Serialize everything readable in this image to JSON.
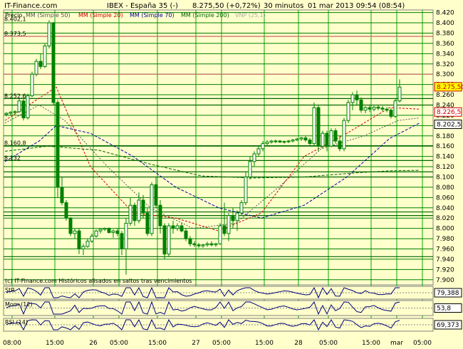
{
  "header": {
    "brand": "IT-Finance.com",
    "title": "IBEX - España 35 (-)",
    "quote": "8.275,50 (+0,72%)",
    "period": "30 minutos",
    "datetime": "01 mar 2013 09:54 (08:54)"
  },
  "legend": {
    "precio": "Precio",
    "mm50": "MM (Simple 50)",
    "mm20": "MM (Simple 20)",
    "mm70": "MM (Simple 70)",
    "mm200": "MM (Simple 200)",
    "vnp": "VNP (25,1)"
  },
  "footer_note": "(c) IT-Finance.com  Históricos alisados en saltos tras vencimientos",
  "colors": {
    "background": "#ffffcc",
    "grid_h": "#008000",
    "grid_v": "#00aa00",
    "candle": "#008000",
    "mm20": "#cc0000",
    "mm50": "#555555",
    "mm70": "#000099",
    "mm200": "#006600"
  },
  "chart_data": {
    "type": "candlestick",
    "y_ticks": [
      "8.420",
      "8.400",
      "8.380",
      "8.360",
      "8.340",
      "8.320",
      "8.300",
      "8.280",
      "8.260",
      "8.240",
      "8.220",
      "8.200",
      "8.180",
      "8.160",
      "8.140",
      "8.120",
      "8.100",
      "8.080",
      "8.060",
      "8.040",
      "8.020",
      "8.000",
      "7.980",
      "7.960",
      "7.940",
      "7.920",
      "7.900"
    ],
    "ylim": [
      7890,
      8425
    ],
    "x_ticks": [
      "08:00",
      "15:00",
      "26",
      "05:00",
      "15:00",
      "27",
      "05:00",
      "15:00",
      "28",
      "05:00",
      "15:00",
      "mar",
      "05:00"
    ],
    "x_tick_index": [
      0,
      10,
      19,
      25,
      34,
      43,
      49,
      59,
      67,
      74,
      84,
      90,
      96
    ],
    "ohlc": [
      [
        8222,
        8226,
        8218,
        8224
      ],
      [
        8224,
        8228,
        8220,
        8226
      ],
      [
        8226,
        8230,
        8222,
        8227
      ],
      [
        8227,
        8252,
        8225,
        8248
      ],
      [
        8248,
        8256,
        8210,
        8215
      ],
      [
        8215,
        8262,
        8212,
        8258
      ],
      [
        8258,
        8305,
        8255,
        8300
      ],
      [
        8300,
        8330,
        8296,
        8325
      ],
      [
        8325,
        8340,
        8310,
        8315
      ],
      [
        8315,
        8360,
        8312,
        8355
      ],
      [
        8355,
        8405,
        8350,
        8400
      ],
      [
        8400,
        8402,
        8240,
        8245
      ],
      [
        8245,
        8250,
        8060,
        8080
      ],
      [
        8080,
        8100,
        8045,
        8050
      ],
      [
        8050,
        8055,
        8015,
        8020
      ],
      [
        8020,
        8022,
        7985,
        7990
      ],
      [
        7990,
        8000,
        7980,
        7995
      ],
      [
        7995,
        8000,
        7950,
        7960
      ],
      [
        7960,
        7970,
        7948,
        7965
      ],
      [
        7965,
        7980,
        7962,
        7975
      ],
      [
        7975,
        7990,
        7972,
        7985
      ],
      [
        7985,
        7998,
        7982,
        7995
      ],
      [
        7995,
        8000,
        7990,
        7998
      ],
      [
        7998,
        8002,
        7995,
        8000
      ],
      [
        8000,
        8002,
        7990,
        7992
      ],
      [
        7992,
        7998,
        7982,
        7995
      ],
      [
        7995,
        8000,
        7985,
        7990
      ],
      [
        7990,
        7995,
        7948,
        7960
      ],
      [
        7960,
        8020,
        7910,
        8010
      ],
      [
        8010,
        8060,
        8005,
        8045
      ],
      [
        8045,
        8050,
        8005,
        8015
      ],
      [
        8015,
        8070,
        8010,
        8055
      ],
      [
        8055,
        8065,
        8020,
        8030
      ],
      [
        8030,
        8040,
        7985,
        7990
      ],
      [
        7990,
        8090,
        7985,
        8085
      ],
      [
        8085,
        8100,
        8040,
        8045
      ],
      [
        8045,
        8055,
        7990,
        8005
      ],
      [
        8005,
        8010,
        7940,
        7950
      ],
      [
        7950,
        8010,
        7945,
        8005
      ],
      [
        8005,
        8015,
        7990,
        8000
      ],
      [
        8000,
        8010,
        7995,
        8005
      ],
      [
        8005,
        8010,
        7992,
        7995
      ],
      [
        7995,
        8000,
        7975,
        7980
      ],
      [
        7980,
        7985,
        7965,
        7970
      ],
      [
        7970,
        7975,
        7964,
        7968
      ],
      [
        7968,
        7972,
        7962,
        7966
      ],
      [
        7966,
        7970,
        7962,
        7968
      ],
      [
        7968,
        7974,
        7964,
        7970
      ],
      [
        7970,
        7975,
        7965,
        7968
      ],
      [
        7968,
        7972,
        7964,
        7970
      ],
      [
        7970,
        8010,
        7968,
        8005
      ],
      [
        8005,
        8050,
        7985,
        7990
      ],
      [
        7990,
        8030,
        7975,
        8025
      ],
      [
        8025,
        8040,
        8000,
        8015
      ],
      [
        8015,
        8035,
        7995,
        8030
      ],
      [
        8030,
        8055,
        8025,
        8050
      ],
      [
        8050,
        8110,
        8045,
        8100
      ],
      [
        8100,
        8140,
        8095,
        8130
      ],
      [
        8130,
        8150,
        8120,
        8145
      ],
      [
        8145,
        8160,
        8140,
        8155
      ],
      [
        8155,
        8170,
        8150,
        8165
      ],
      [
        8165,
        8172,
        8160,
        8168
      ],
      [
        8168,
        8172,
        8165,
        8170
      ],
      [
        8170,
        8173,
        8166,
        8170
      ],
      [
        8170,
        8172,
        8166,
        8168
      ],
      [
        8168,
        8171,
        8165,
        8169
      ],
      [
        8169,
        8172,
        8166,
        8170
      ],
      [
        8170,
        8174,
        8167,
        8172
      ],
      [
        8172,
        8176,
        8170,
        8174
      ],
      [
        8174,
        8178,
        8170,
        8176
      ],
      [
        8176,
        8180,
        8168,
        8172
      ],
      [
        8172,
        8176,
        8162,
        8165
      ],
      [
        8165,
        8245,
        8160,
        8235
      ],
      [
        8235,
        8240,
        8150,
        8160
      ],
      [
        8160,
        8190,
        8155,
        8185
      ],
      [
        8185,
        8190,
        8150,
        8160
      ],
      [
        8160,
        8195,
        8158,
        8190
      ],
      [
        8190,
        8195,
        8165,
        8170
      ],
      [
        8170,
        8180,
        8150,
        8155
      ],
      [
        8155,
        8215,
        8150,
        8210
      ],
      [
        8210,
        8250,
        8205,
        8245
      ],
      [
        8245,
        8265,
        8230,
        8260
      ],
      [
        8260,
        8268,
        8240,
        8250
      ],
      [
        8250,
        8255,
        8225,
        8230
      ],
      [
        8230,
        8238,
        8224,
        8235
      ],
      [
        8235,
        8240,
        8226,
        8232
      ],
      [
        8232,
        8238,
        8228,
        8236
      ],
      [
        8236,
        8240,
        8230,
        8234
      ],
      [
        8234,
        8238,
        8228,
        8232
      ],
      [
        8232,
        8236,
        8226,
        8230
      ],
      [
        8230,
        8234,
        8214,
        8218
      ],
      [
        8218,
        8252,
        8215,
        8248
      ],
      [
        8248,
        8290,
        8245,
        8275
      ]
    ],
    "mm20": [
      [
        0,
        8210
      ],
      [
        12,
        8275
      ],
      [
        20,
        8120
      ],
      [
        30,
        8030
      ],
      [
        40,
        8020
      ],
      [
        50,
        7995
      ],
      [
        60,
        8030
      ],
      [
        70,
        8140
      ],
      [
        80,
        8185
      ],
      [
        90,
        8235
      ],
      [
        97,
        8232
      ]
    ],
    "mm50": [
      [
        0,
        8205
      ],
      [
        8,
        8240
      ],
      [
        14,
        8210
      ],
      [
        24,
        8120
      ],
      [
        34,
        8040
      ],
      [
        44,
        8000
      ],
      [
        54,
        8010
      ],
      [
        64,
        8080
      ],
      [
        74,
        8155
      ],
      [
        84,
        8180
      ],
      [
        92,
        8210
      ],
      [
        97,
        8215
      ]
    ],
    "mm70": [
      [
        0,
        8130
      ],
      [
        8,
        8170
      ],
      [
        12,
        8200
      ],
      [
        20,
        8185
      ],
      [
        30,
        8140
      ],
      [
        40,
        8080
      ],
      [
        50,
        8040
      ],
      [
        60,
        8020
      ],
      [
        70,
        8045
      ],
      [
        80,
        8100
      ],
      [
        90,
        8175
      ],
      [
        97,
        8205
      ]
    ],
    "mm200": [
      [
        0,
        8150
      ],
      [
        10,
        8160
      ],
      [
        22,
        8152
      ],
      [
        34,
        8125
      ],
      [
        46,
        8102
      ],
      [
        58,
        8098
      ],
      [
        70,
        8100
      ],
      [
        82,
        8108
      ],
      [
        90,
        8112
      ],
      [
        97,
        8113
      ]
    ],
    "price_labels": [
      "8.402,1",
      "8.373,5",
      "8.252,6",
      "8.160,8",
      "8.132"
    ],
    "price_label_values": [
      8402.1,
      8373.5,
      8252.6,
      8160.8,
      8132
    ],
    "hlines": [
      8373.5,
      8300,
      8252.6,
      8240,
      8160.8,
      8132,
      8110,
      8100,
      8032,
      8025,
      7945
    ],
    "badges": [
      {
        "text": "8.275,50",
        "value": 8275.5,
        "bg": "#ffff00",
        "fg": "#cc0000",
        "border": "#cc0000"
      },
      {
        "text": "8.226,5",
        "value": 8226.5,
        "bg": "#ffffff",
        "fg": "#cc0000",
        "border": "#cc0000"
      },
      {
        "text": "8.202,5",
        "value": 8202.5,
        "bg": "#ffffff",
        "fg": "#000000",
        "border": "#000000"
      }
    ],
    "indicators": [
      {
        "name": "StR",
        "params": "",
        "value": "79,388"
      },
      {
        "name": "Mom",
        "params": "(12)",
        "value": "53,8"
      },
      {
        "name": "RSI",
        "params": "(14)",
        "value": "69,373"
      }
    ]
  }
}
